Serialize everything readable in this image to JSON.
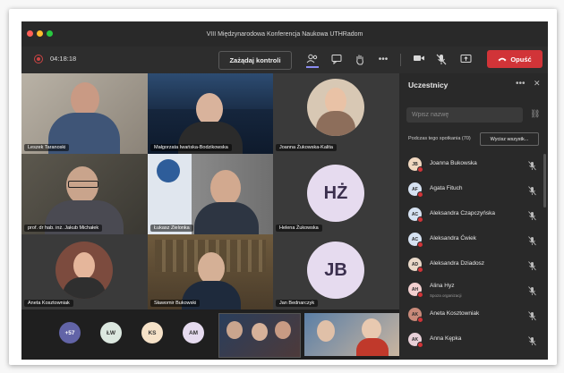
{
  "window": {
    "title": "VIII Międzynarodowa Konferencja Naukowa UTHRadom"
  },
  "toolbar": {
    "timer": "04:18:18",
    "control_label": "Zażądaj kontroli",
    "leave_label": "Opuść"
  },
  "video_tiles": [
    {
      "name": "Leszek Taranoski"
    },
    {
      "name": "Małgorzata Iwańska-Bodzikowska"
    },
    {
      "name": "Joanna Żukowska-Kalita"
    },
    {
      "name": "prof. dr hab. inż. Jakub Michałek"
    },
    {
      "name": "Łukasz Zielonka"
    },
    {
      "name": "Helena Żukowska",
      "initials": "HŻ"
    },
    {
      "name": "Aneta Kosztowniak"
    },
    {
      "name": "Sławomir Bukowski"
    },
    {
      "name": "Jan Bednarczyk",
      "initials": "JB"
    }
  ],
  "overflow": {
    "more_count": "+57",
    "avatars": [
      {
        "initials": "ŁW",
        "color": "#dce8e0"
      },
      {
        "initials": "KS",
        "color": "#f6e2c8"
      },
      {
        "initials": "AM",
        "color": "#e6dbef"
      }
    ]
  },
  "participants_panel": {
    "title": "Uczestnicy",
    "search_placeholder": "Wpisz nazwę",
    "section_label": "Podczas tego spotkania (70)",
    "mute_all_label": "Wycisz wszystk...",
    "participants": [
      {
        "name": "Joanna Bukowska",
        "initials": "JB",
        "color": "#f1d8c0"
      },
      {
        "name": "Agata Fituch",
        "initials": "AF",
        "color": "#d6e2f2"
      },
      {
        "name": "Aleksandra Czapczyńska",
        "initials": "AC",
        "color": "#d6e2f2"
      },
      {
        "name": "Aleksandra Ćwiek",
        "initials": "AC",
        "color": "#d6e2f2"
      },
      {
        "name": "Aleksandra Dziadosz",
        "initials": "AD",
        "color": "#ead9c9"
      },
      {
        "name": "Alina Hyz",
        "subtitle": "Spoza organizacji",
        "initials": "AH",
        "color": "#f3d0d0"
      },
      {
        "name": "Aneta Kosztowniak",
        "initials": "AK",
        "color": "#c98a7a"
      },
      {
        "name": "Anna Kępka",
        "initials": "AK",
        "color": "#e8d0d8"
      }
    ]
  },
  "colors": {
    "accent": "#8b8cf0",
    "leave": "#d13438",
    "avatar": "#e6dbef"
  }
}
